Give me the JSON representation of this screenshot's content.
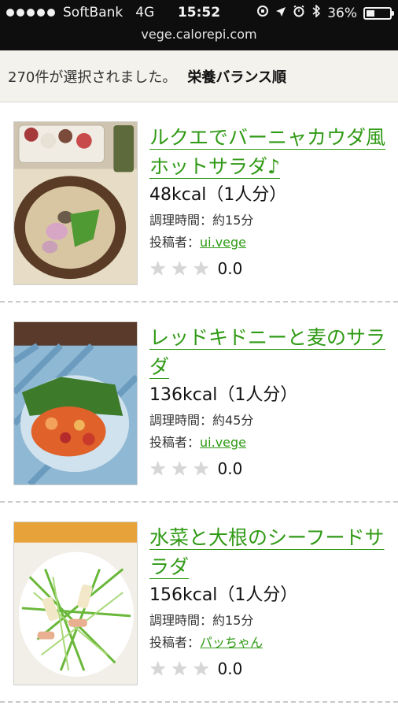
{
  "status_bar": {
    "carrier": "SoftBank",
    "network": "4G",
    "time": "15:52",
    "battery": "36%",
    "battery_level": 0.36,
    "icons": [
      "lock-rotation-icon",
      "location-icon",
      "alarm-icon",
      "bluetooth-icon"
    ],
    "url": "vege.calorepi.com"
  },
  "results": {
    "count_text": "270件が選択されました。",
    "sort_label": "栄養バランス順"
  },
  "labels": {
    "time_prefix": "調理時間：",
    "author_prefix": "投稿者："
  },
  "recipes": [
    {
      "title": "ルクエでバーニャカウダ風ホットサラダ♪",
      "kcal": "48kcal（1人分）",
      "cook_time": "約15分",
      "author": "ui.vege",
      "rating": "0.0",
      "stars": 0
    },
    {
      "title": "レッドキドニーと麦のサラダ",
      "kcal": "136kcal（1人分）",
      "cook_time": "約45分",
      "author": "ui.vege",
      "rating": "0.0",
      "stars": 0
    },
    {
      "title": "水菜と大根のシーフードサラダ",
      "kcal": "156kcal（1人分）",
      "cook_time": "約15分",
      "author": "パッちゃん",
      "rating": "0.0",
      "stars": 0
    }
  ],
  "colors": {
    "link": "#2f9a14",
    "status_bar_bg": "#0e0e0e",
    "header_bg": "#f4f2ec"
  }
}
